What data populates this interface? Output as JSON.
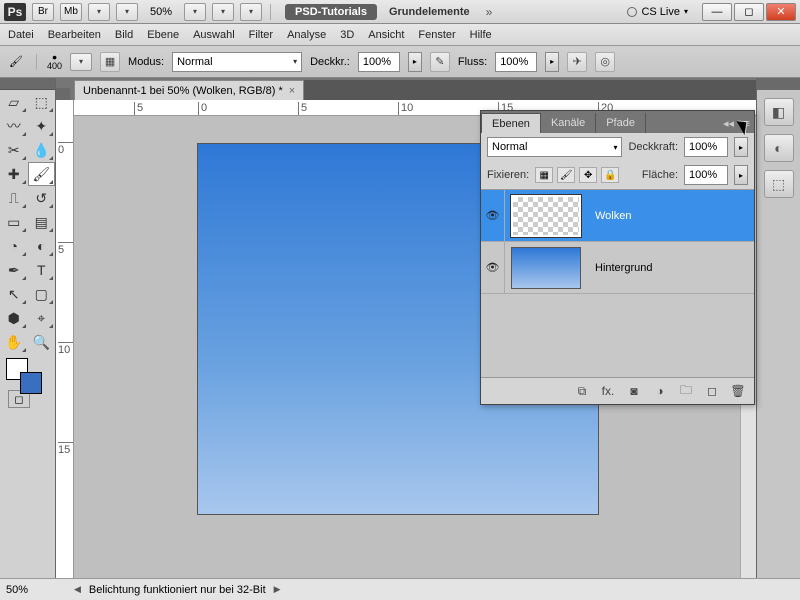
{
  "titlebar": {
    "zoom": "50%",
    "workspace_label": "PSD-Tutorials",
    "doc_label": "Grundelemente",
    "cslive": "CS Live"
  },
  "menu": [
    "Datei",
    "Bearbeiten",
    "Bild",
    "Ebene",
    "Auswahl",
    "Filter",
    "Analyse",
    "3D",
    "Ansicht",
    "Fenster",
    "Hilfe"
  ],
  "options": {
    "brush_size": "400",
    "mode_label": "Modus:",
    "mode_value": "Normal",
    "opacity_label": "Deckkr.:",
    "opacity_value": "100%",
    "flow_label": "Fluss:",
    "flow_value": "100%"
  },
  "document": {
    "tab_title": "Unbenannt-1 bei 50% (Wolken, RGB/8) *",
    "ruler_marks": [
      "5",
      "0",
      "5",
      "10",
      "15",
      "20"
    ]
  },
  "layers_panel": {
    "tabs": [
      "Ebenen",
      "Kanäle",
      "Pfade"
    ],
    "blend_mode": "Normal",
    "opacity_label": "Deckkraft:",
    "opacity_value": "100%",
    "lock_label": "Fixieren:",
    "fill_label": "Fläche:",
    "fill_value": "100%",
    "layers": [
      {
        "name": "Wolken"
      },
      {
        "name": "Hintergrund"
      }
    ]
  },
  "status": {
    "zoom": "50%",
    "message": "Belichtung funktioniert nur bei 32-Bit"
  }
}
